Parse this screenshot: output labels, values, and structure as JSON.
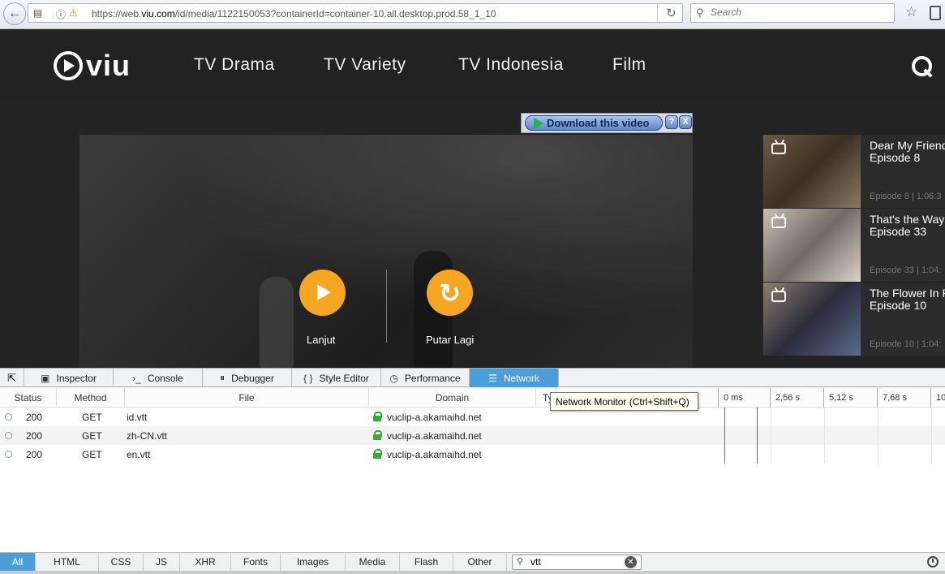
{
  "browser": {
    "url_prefix": "https://web.",
    "url_domain": "viu.com",
    "url_path": "/id/media/1122150053?containerId=container-10.all.desktop.prod.58_1_10",
    "search_placeholder": "Search"
  },
  "site": {
    "logo_text": "viu",
    "nav": [
      "TV Drama",
      "TV Variety",
      "TV Indonesia",
      "Film"
    ],
    "accent_color": "#f5a623"
  },
  "player": {
    "continue_label": "Lanjut",
    "replay_label": "Putar Lagi",
    "download_label": "Download this video",
    "help_label": "?",
    "close_label": "X"
  },
  "episodes": [
    {
      "title": "Dear My Friends",
      "episode": "Episode 8",
      "meta": "Episode 8 | 1:06:3"
    },
    {
      "title": "That's the Way",
      "episode": "Episode 33",
      "meta": "Episode 33 | 1:04:"
    },
    {
      "title": "The Flower In P",
      "episode": "Episode 10",
      "meta": "Episode 10 | 1:04:"
    }
  ],
  "devtools": {
    "tabs": [
      "Inspector",
      "Console",
      "Debugger",
      "Style Editor",
      "Performance",
      "Network"
    ],
    "active_tab": "Network",
    "columns": {
      "status": "Status",
      "method": "Method",
      "file": "File",
      "domain": "Domain",
      "type": "Ty"
    },
    "timeline_ticks": [
      "0 ms",
      "2,56 s",
      "5,12 s",
      "7,68 s",
      "10"
    ],
    "requests": [
      {
        "status": "200",
        "method": "GET",
        "file": "id.vtt",
        "domain": "vuclip-a.akamaihd.net"
      },
      {
        "status": "200",
        "method": "GET",
        "file": "zh-CN.vtt",
        "domain": "vuclip-a.akamaihd.net"
      },
      {
        "status": "200",
        "method": "GET",
        "file": "en.vtt",
        "domain": "vuclip-a.akamaihd.net"
      }
    ],
    "tooltip": "Network Monitor (Ctrl+Shift+Q)",
    "filters": [
      "All",
      "HTML",
      "CSS",
      "JS",
      "XHR",
      "Fonts",
      "Images",
      "Media",
      "Flash",
      "Other"
    ],
    "active_filter": "All",
    "filter_value": "vtt"
  }
}
